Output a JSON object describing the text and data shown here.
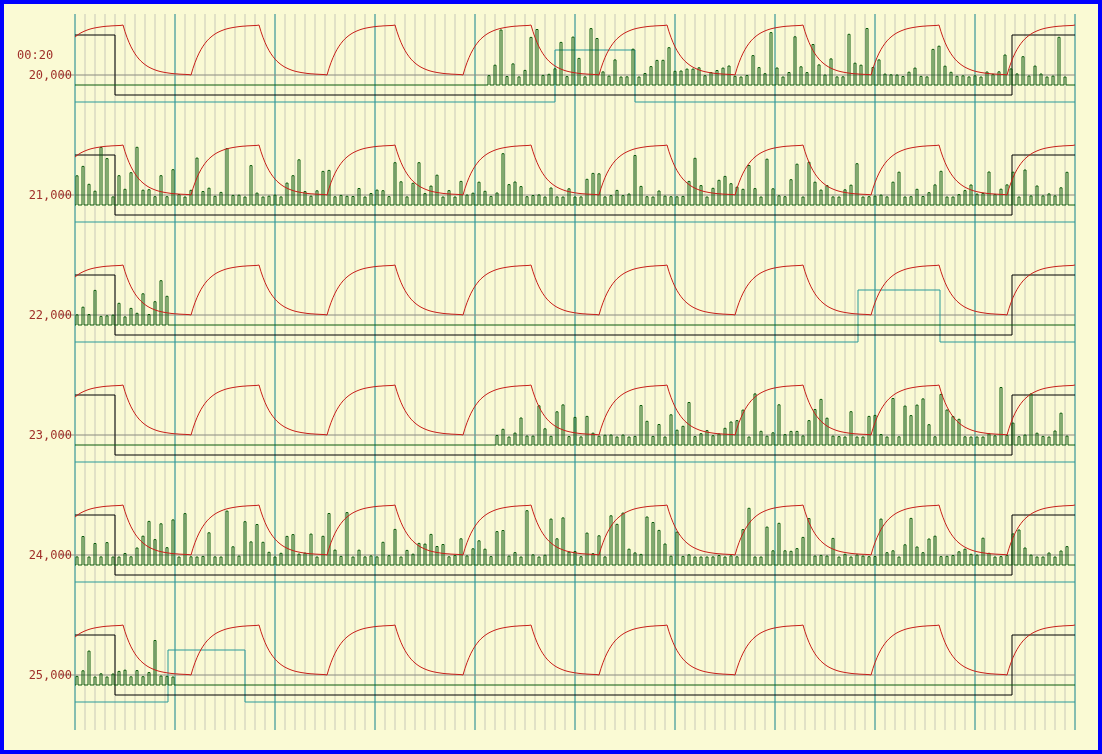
{
  "time_label": "00:20",
  "rows": [
    {
      "label": "20,000"
    },
    {
      "label": "21,000"
    },
    {
      "label": "22,000"
    },
    {
      "label": "23,000"
    },
    {
      "label": "24,000"
    },
    {
      "label": "25,000"
    }
  ]
}
